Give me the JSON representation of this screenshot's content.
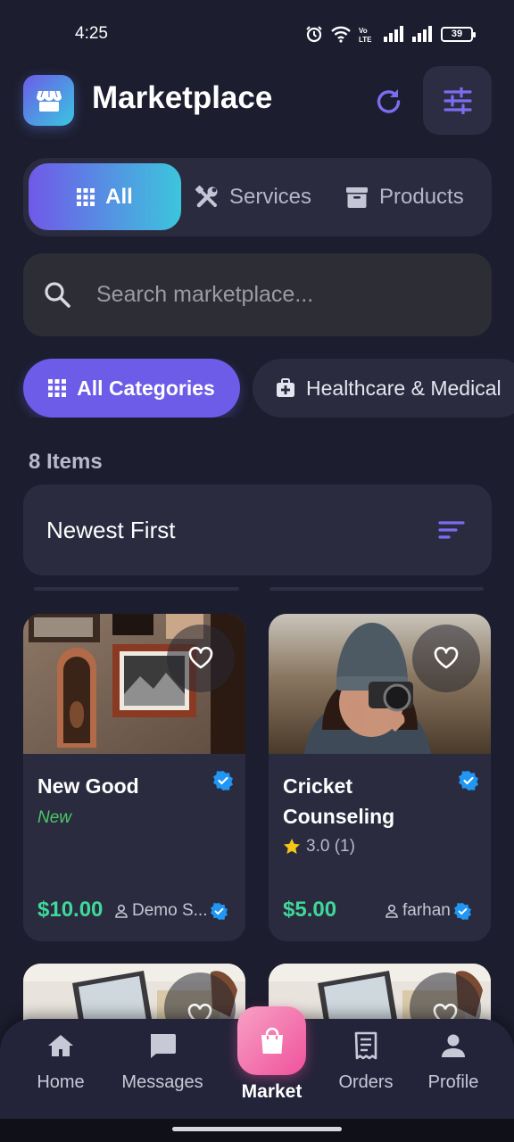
{
  "status": {
    "time": "4:25",
    "battery": "39"
  },
  "header": {
    "title": "Marketplace"
  },
  "segments": [
    {
      "label": "All",
      "icon": "grid-icon",
      "active": true
    },
    {
      "label": "Services",
      "icon": "tools-icon",
      "active": false
    },
    {
      "label": "Products",
      "icon": "archive-box-icon",
      "active": false
    }
  ],
  "search": {
    "placeholder": "Search marketplace..."
  },
  "categories": [
    {
      "label": "All Categories",
      "icon": "grid-icon",
      "active": true
    },
    {
      "label": "Healthcare & Medical",
      "icon": "medical-kit-icon",
      "active": false
    }
  ],
  "results": {
    "count": "8 Items"
  },
  "sort": {
    "label": "Newest First"
  },
  "listings": [
    {
      "title": "New Good",
      "tag": "New",
      "price": "$10.00",
      "seller": "Demo S...",
      "verified": true,
      "image": "wall-frames-photo"
    },
    {
      "title": "Cricket Counseling",
      "rating": "3.0 (1)",
      "price": "$5.00",
      "seller": "farhan",
      "verified": true,
      "image": "photographer-photo"
    }
  ],
  "nav": {
    "home": "Home",
    "messages": "Messages",
    "market": "Market",
    "orders": "Orders",
    "profile": "Profile"
  },
  "colors": {
    "accent": "#6c5ce7",
    "price": "#3fd89a",
    "new_tag": "#4cc766",
    "verified": "#2196f3",
    "market": "#f0529c",
    "background": "#1c1d2e"
  }
}
